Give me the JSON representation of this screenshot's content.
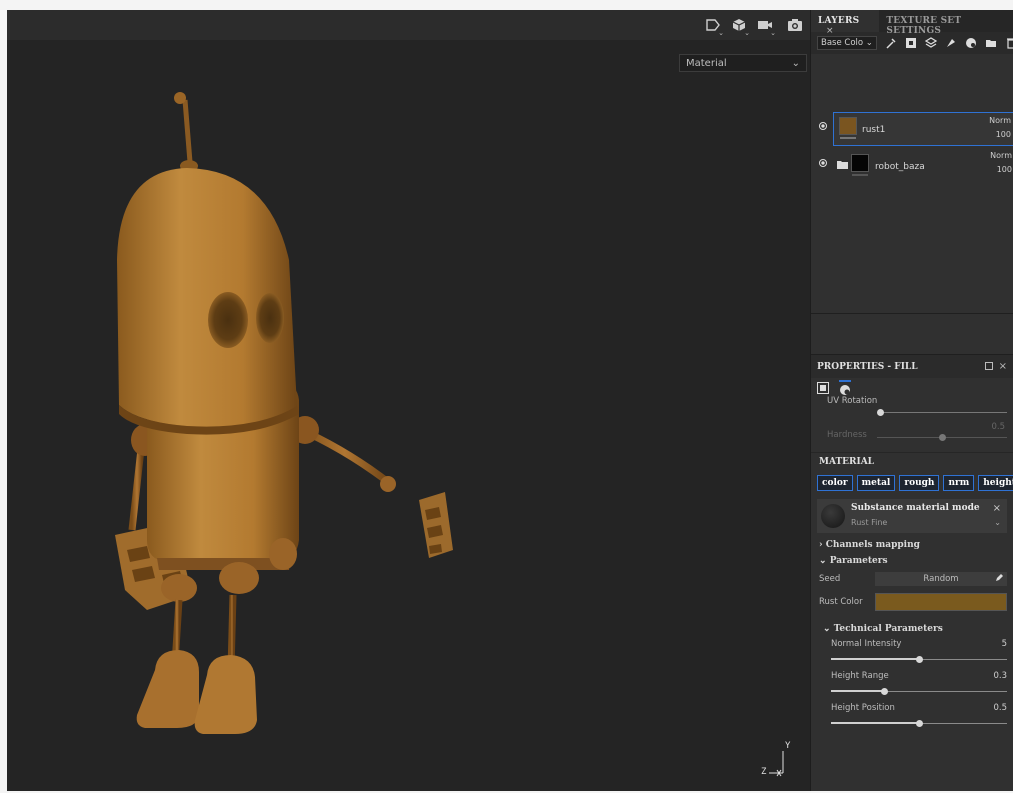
{
  "viewport": {
    "mode_select": "Material",
    "gizmo_labels": [
      "Z",
      "Y"
    ],
    "tools": [
      "selection-icon",
      "cube-icon",
      "camera-icon",
      "screenshot-icon"
    ]
  },
  "panel": {
    "tabs": [
      {
        "label": "LAYERS",
        "close": "×"
      },
      {
        "label": "TEXTURE SET SETTINGS"
      }
    ],
    "channel_select": "Base Colo",
    "layers": [
      {
        "name": "rust1",
        "blend": "Norm",
        "opacity": "100",
        "thumb_color": "#7a5520"
      },
      {
        "name": "robot_baza",
        "blend": "Norm",
        "opacity": "100",
        "thumb_color": "#050505"
      }
    ],
    "properties": {
      "title": "PROPERTIES - FILL",
      "uv_rotation_label": "UV Rotation",
      "hardness_label": "Hardness",
      "hardness_value": "0.5",
      "material_section": "MATERIAL",
      "channels": [
        "color",
        "metal",
        "rough",
        "nrm",
        "height"
      ],
      "substance_title": "Substance material mode",
      "substance_name": "Rust Fine",
      "channels_mapping": "Channels mapping",
      "parameters": "Parameters",
      "seed_label": "Seed",
      "seed_value": "Random",
      "rust_color_label": "Rust Color",
      "rust_color": "#7a5a1e",
      "technical": "Technical Parameters",
      "tech_sliders": [
        {
          "label": "Normal Intensity",
          "value": "5",
          "fraction": 0.5
        },
        {
          "label": "Height Range",
          "value": "0.3",
          "fraction": 0.3
        },
        {
          "label": "Height Position",
          "value": "0.5",
          "fraction": 0.5
        }
      ]
    }
  },
  "colors": {
    "accent": "#2f72d4",
    "viewport_bg": "#242424",
    "panel_bg": "#303030"
  }
}
